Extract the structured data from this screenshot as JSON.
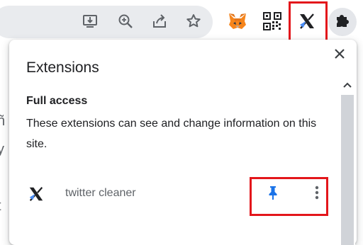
{
  "toolbar": {
    "icons": [
      "install-download-icon",
      "zoom-icon",
      "share-icon",
      "bookmark-star-icon",
      "metamask-fox-icon",
      "qr-code-icon",
      "x-extension-icon",
      "extensions-puzzle-icon"
    ],
    "accent_color": "#1a73e8",
    "highlight_color": "#e3161b"
  },
  "background_page": {
    "fragments": [
      "ñ",
      "y",
      "t"
    ]
  },
  "popup": {
    "title": "Extensions",
    "close_icon": "close-icon",
    "section": {
      "heading": "Full access",
      "description": "These extensions can see and change information on this site."
    },
    "extensions": [
      {
        "name": "twitter cleaner",
        "icon": "x-logo-icon",
        "pinned": true
      }
    ]
  }
}
